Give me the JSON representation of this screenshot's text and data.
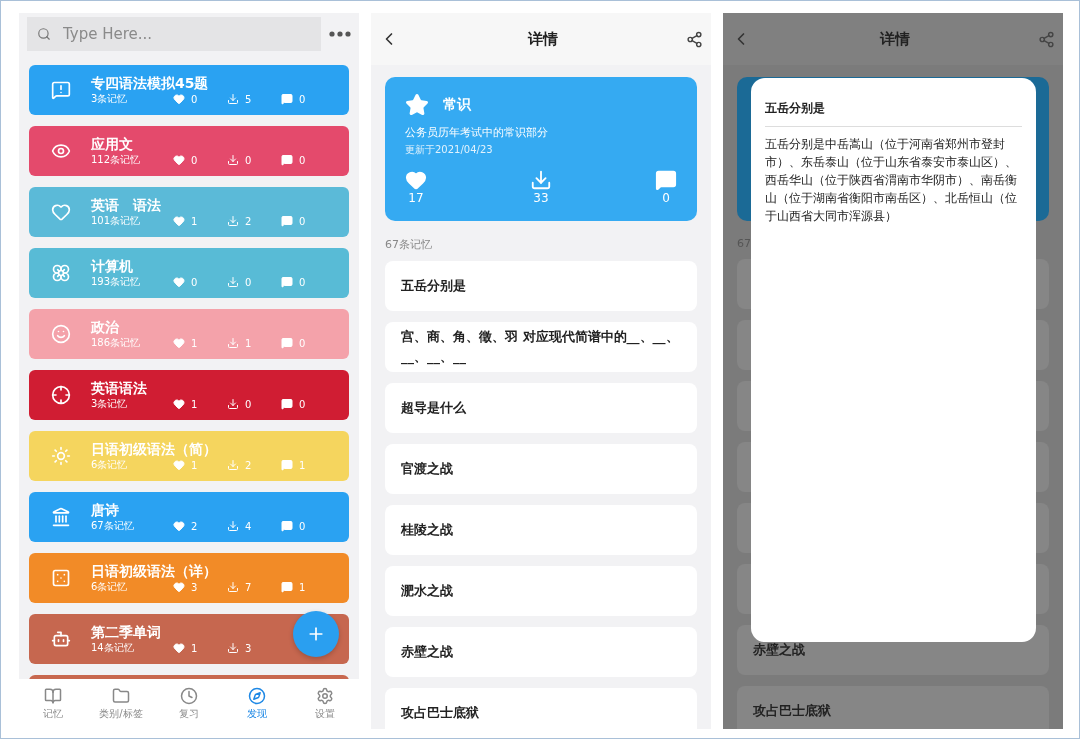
{
  "list_screen": {
    "search": {
      "placeholder": "Type Here..."
    },
    "decks": [
      {
        "title": "专四语法模拟45题",
        "count": "3条记忆",
        "likes": "0",
        "downloads": "5",
        "comments": "0",
        "color": "#2aa2f2"
      },
      {
        "title": "应用文",
        "count": "112条记忆",
        "likes": "0",
        "downloads": "0",
        "comments": "0",
        "color": "#e44a6c"
      },
      {
        "title": "英语　语法",
        "count": "101条记忆",
        "likes": "1",
        "downloads": "2",
        "comments": "0",
        "color": "#5bbad8"
      },
      {
        "title": "计算机",
        "count": "193条记忆",
        "likes": "0",
        "downloads": "0",
        "comments": "0",
        "color": "#58bbd6"
      },
      {
        "title": "政治",
        "count": "186条记忆",
        "likes": "1",
        "downloads": "1",
        "comments": "0",
        "color": "#f4a2aa"
      },
      {
        "title": "英语语法",
        "count": "3条记忆",
        "likes": "1",
        "downloads": "0",
        "comments": "0",
        "color": "#d01d33"
      },
      {
        "title": "日语初级语法（简）",
        "count": "6条记忆",
        "likes": "1",
        "downloads": "2",
        "comments": "1",
        "color": "#f5d55e"
      },
      {
        "title": "唐诗",
        "count": "67条记忆",
        "likes": "2",
        "downloads": "4",
        "comments": "0",
        "color": "#2aa2f2"
      },
      {
        "title": "日语初级语法（详）",
        "count": "6条记忆",
        "likes": "3",
        "downloads": "7",
        "comments": "1",
        "color": "#f28b27"
      },
      {
        "title": "第二季单词",
        "count": "14条记忆",
        "likes": "1",
        "downloads": "3",
        "color": "#c6674f"
      },
      {
        "color": "#c8684f"
      }
    ],
    "nav": [
      {
        "label": "记忆",
        "selected": false
      },
      {
        "label": "类别/标签",
        "selected": false
      },
      {
        "label": "复习",
        "selected": false
      },
      {
        "label": "发现",
        "selected": true
      },
      {
        "label": "设置",
        "selected": false
      }
    ]
  },
  "detail_screen": {
    "title": "详情",
    "card": {
      "name": "常识",
      "description": "公务员历年考试中的常识部分",
      "updated": "更新于2021/04/23",
      "likes": "17",
      "downloads": "33",
      "comments": "0"
    },
    "count": "67条记忆",
    "items": [
      "五岳分别是",
      "宫、商、角、徵、羽 对应现代简谱中的__、__、__、__、__",
      "超导是什么",
      "官渡之战",
      "桂陵之战",
      "淝水之战",
      "赤壁之战",
      "攻占巴士底狱"
    ]
  },
  "dialog_screen": {
    "title": "详情",
    "count_peek": "67",
    "dialog": {
      "title": "五岳分别是",
      "body": "五岳分别是中岳嵩山（位于河南省郑州市登封市）、东岳泰山（位于山东省泰安市泰山区）、西岳华山（位于陕西省渭南市华阴市）、南岳衡山（位于湖南省衡阳市南岳区）、北岳恒山（位于山西省大同市浑源县）"
    },
    "items": [
      "赤壁之战",
      "攻占巴士底狱"
    ]
  }
}
